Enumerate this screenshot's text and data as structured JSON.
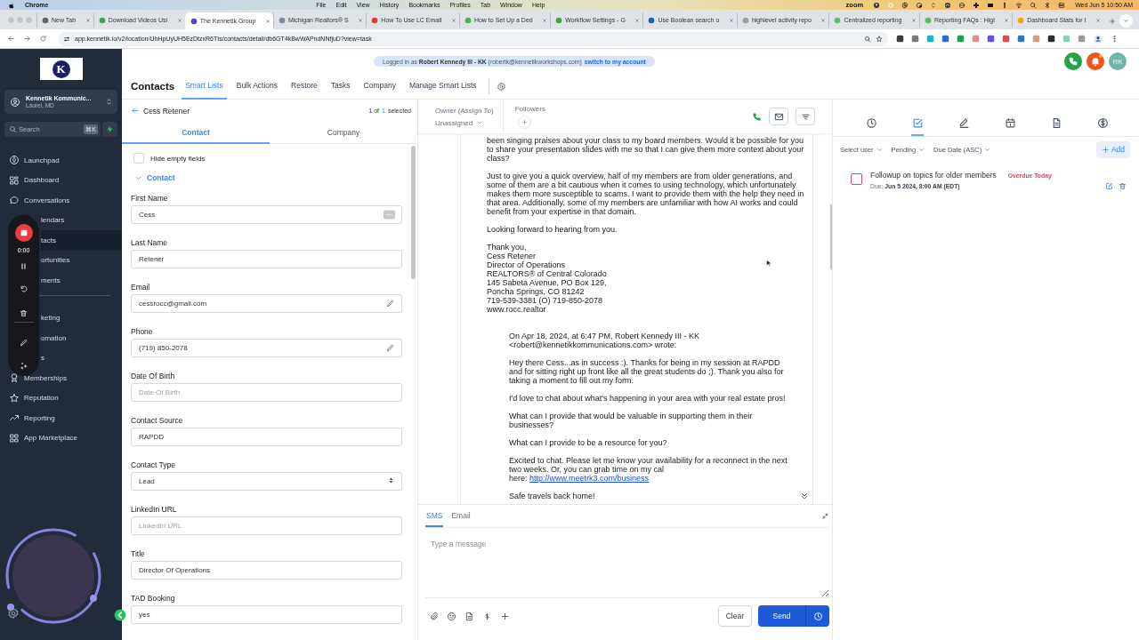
{
  "menubar": {
    "app": "Chrome",
    "menus": [
      "File",
      "Edit",
      "View",
      "History",
      "Bookmarks",
      "Profiles",
      "Tab",
      "Window",
      "Help"
    ],
    "status_label": "zoom",
    "clock": "Wed Jun 5 10:50 AM"
  },
  "browser_tabs": [
    {
      "title": "New Tab",
      "selected": false,
      "color": "#5f6368"
    },
    {
      "title": "Download Videos Usi",
      "selected": false,
      "color": "#34a853"
    },
    {
      "title": "The Kennetik Group",
      "selected": true,
      "color": "#5b3fc4"
    },
    {
      "title": "Michigan Realtors® S",
      "selected": false,
      "color": "#7a8a99"
    },
    {
      "title": "How To Use LC Email",
      "selected": false,
      "color": "#e53935"
    },
    {
      "title": "How to Set Up a Ded",
      "selected": false,
      "color": "#4caf50"
    },
    {
      "title": "Workflow Settings - G",
      "selected": false,
      "color": "#43a047"
    },
    {
      "title": "Use Boolean search o",
      "selected": false,
      "color": "#0a66c2"
    },
    {
      "title": "highlevel activity repo",
      "selected": false,
      "color": "#9e9e9e"
    },
    {
      "title": "Centralized reporting",
      "selected": false,
      "color": "#66bb6a"
    },
    {
      "title": "Reporting FAQs : Higl",
      "selected": false,
      "color": "#5cb85c"
    },
    {
      "title": "Dashboard Stats for I",
      "selected": false,
      "color": "#f4a300"
    }
  ],
  "address_bar": {
    "url": "app.kennetik.io/v2/location/UhHpUyUH5EzDtzxR6TIs/contacts/detail/db6GT4kBwWAPndNNfjuD?view=task"
  },
  "sidebar": {
    "logo": "K",
    "account": {
      "name": "Kennetik Kommunic...",
      "location": "Laurel, MD"
    },
    "search": {
      "placeholder": "Search",
      "shortcut": "⌘K"
    },
    "nav_groups": [
      {
        "items": [
          {
            "label": "Launchpad",
            "kind": "launchpad",
            "selected": false
          },
          {
            "label": "Dashboard",
            "kind": "dashboard",
            "selected": false
          },
          {
            "label": "Conversations",
            "kind": "conversations",
            "selected": false
          },
          {
            "label": "lendars",
            "kind": "covered",
            "selected": false
          },
          {
            "label": "tacts",
            "kind": "covered",
            "selected": true
          },
          {
            "label": "ortunities",
            "kind": "covered",
            "selected": false
          },
          {
            "label": "ments",
            "kind": "covered",
            "selected": false
          }
        ]
      },
      {
        "items": [
          {
            "label": "keting",
            "kind": "covered",
            "selected": false
          },
          {
            "label": "omation",
            "kind": "covered",
            "selected": false
          },
          {
            "label": "s",
            "kind": "covered",
            "selected": false
          },
          {
            "label": "Memberships",
            "kind": "memberships",
            "selected": false
          },
          {
            "label": "Reputation",
            "kind": "reputation",
            "selected": false
          },
          {
            "label": "Reporting",
            "kind": "reporting",
            "selected": false
          },
          {
            "label": "App Marketplace",
            "kind": "marketplace",
            "selected": false
          }
        ]
      }
    ]
  },
  "recorder": {
    "time": "0:00"
  },
  "banner": {
    "text": "Logged in as **Robert Kennedy III - KK** (robertk@kennetikworkshops.com)",
    "link": "switch to my account"
  },
  "header": {
    "avatar": "RK"
  },
  "contacts_nav": {
    "title": "Contacts",
    "tabs": [
      {
        "label": "Smart Lists",
        "selected": true
      },
      {
        "label": "Bulk Actions",
        "selected": false
      },
      {
        "label": "Restore",
        "selected": false
      },
      {
        "label": "Tasks",
        "selected": false
      },
      {
        "label": "Company",
        "selected": false
      },
      {
        "label": "Manage Smart Lists",
        "selected": false
      }
    ]
  },
  "contact": {
    "name": "Cess Retener",
    "selection": {
      "prefix": "1 of",
      "current": "1",
      "suffix": "selected"
    },
    "tabs": [
      {
        "label": "Contact",
        "selected": true
      },
      {
        "label": "Company",
        "selected": false
      }
    ],
    "hide_empty": {
      "label": "Hide empty fields",
      "checked": false
    },
    "section": {
      "label": "Contact",
      "expanded": true
    },
    "fields": [
      {
        "label": "First Name",
        "value": "Cess",
        "kind": "more"
      },
      {
        "label": "Last Name",
        "value": "Retener",
        "kind": "text"
      },
      {
        "label": "Email",
        "value": "cessrocc@gmail.com",
        "kind": "editable"
      },
      {
        "label": "Phone",
        "value": "(719) 850-2078",
        "kind": "editable"
      },
      {
        "label": "Date Of Birth",
        "placeholder": "Date Of Birth",
        "kind": "text"
      },
      {
        "label": "Contact Source",
        "value": "RAPDD",
        "kind": "text"
      },
      {
        "label": "Contact Type",
        "value": "Lead",
        "kind": "select"
      },
      {
        "label": "LinkedIn URL",
        "placeholder": "LinkedIn URL",
        "kind": "text"
      },
      {
        "label": "Title",
        "value": "Director Of Operations",
        "kind": "text"
      },
      {
        "label": "TAD Booking",
        "value": "yes",
        "kind": "text"
      }
    ]
  },
  "conversation": {
    "owner_label": "Owner (Assign To)",
    "owner": "Unassigned",
    "followers_label": "Followers",
    "email": {
      "paragraphs": [
        "been singing praises about your class to my board members. Would it be possible for you to share your presentation slides with me so that I can give them more context about your class?",
        "Just to give you a quick overview, half of my members are from older generations, and some of them are a bit cautious when it comes to using technology, which unfortunately makes them more susceptible to scams. I want to provide them with the help they need in that area. Additionally, some of my members are unfamiliar with how AI works and could benefit from your expertise in that domain.",
        "Looking forward to hearing from you.",
        "Thank you,\nCess Retener\nDirector of Operations\nREALTORS® of Central Colorado\n145 Sabeta Avenue, PO Box 129,\nPoncha Springs, CO 81242\n719-539-3381 (O) 719-850-2078\nwww.rocc.realtor"
      ],
      "quote": {
        "header": "On Apr 18, 2024, at 6:47 PM, Robert Kennedy III - KK <robert@kennetikkommunications.com> wrote:",
        "paragraphs": [
          {
            "text": "Hey there Cess...as in success :). Thanks for being in my session at RAPDD and for sitting right up front like all the great students do ;). Thank you also for taking a moment to fill out my form."
          },
          {
            "text": "I'd love to chat about what's happening in your area with your real estate pros!"
          },
          {
            "text": "What can I provide that would be valuable in supporting them in their businesses?"
          },
          {
            "text": "What can I provide to be a resource for you?"
          },
          {
            "text": "Excited to chat. Please let me know your availability for a reconnect in the next two weeks. Or, you can grab time on my cal\nhere:",
            "link": "http://www.meetrk3.com/business"
          },
          {
            "text": "Safe travels back home!"
          }
        ]
      }
    },
    "compose": {
      "tabs": [
        {
          "label": "SMS",
          "selected": true
        },
        {
          "label": "Email",
          "selected": false
        }
      ],
      "placeholder": "Type a message",
      "clear": "Clear",
      "send": "Send"
    }
  },
  "tasks_panel": {
    "tabs": [
      {
        "kind": "activity",
        "selected": false
      },
      {
        "kind": "tasks",
        "selected": true
      },
      {
        "kind": "notes",
        "selected": false
      },
      {
        "kind": "appointments",
        "selected": false
      },
      {
        "kind": "documents",
        "selected": false
      },
      {
        "kind": "payments",
        "selected": false
      }
    ],
    "filters": [
      "Select user",
      "Pending",
      "Due Date (ASC)"
    ],
    "add": "Add",
    "tasks": [
      {
        "title": "Followup on topics for older members",
        "status": "Overdue Today",
        "due": "Due: **Jun 5 2024, 8:00 AM (EDT)**",
        "checked": false
      }
    ]
  }
}
